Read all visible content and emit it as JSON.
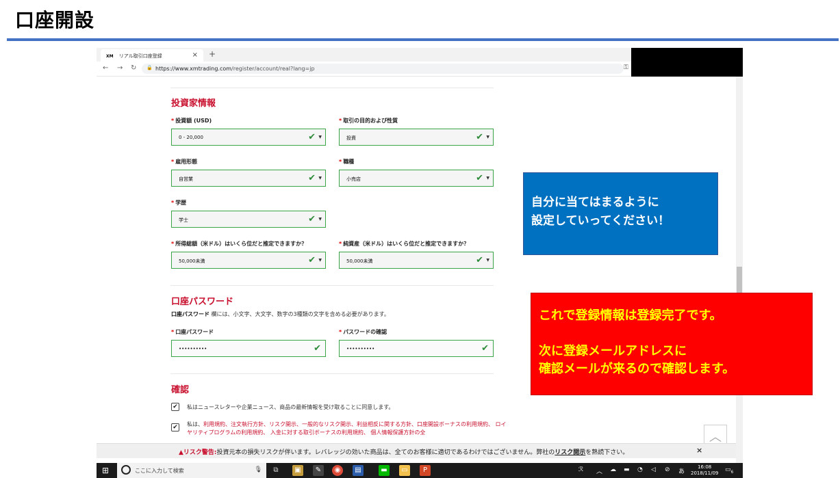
{
  "slide": {
    "title": "口座開設",
    "accent_color": "#4472c4"
  },
  "browser": {
    "tab_title": "リアル取引口座登録",
    "tab_favicon": "XM",
    "url_host": "https://www.xmtrading.com",
    "url_path": "/register/account/real?lang=jp"
  },
  "form": {
    "investor_section_title": "投資家情報",
    "investment_amount": {
      "label": "投資額 (USD)",
      "value": "0 - 20,000"
    },
    "trading_purpose": {
      "label": "取引の目的および性質",
      "value": "投資"
    },
    "employment": {
      "label": "雇用形態",
      "value": "自営業"
    },
    "occupation": {
      "label": "職種",
      "value": "小売店"
    },
    "education": {
      "label": "学歴",
      "value": "学士"
    },
    "annual_income": {
      "label": "所得総額（米ドル）はいくら位だと推定できますか？",
      "value": "50,000未満"
    },
    "net_worth": {
      "label": "純資産（米ドル）はいくら位だと推定できますか？",
      "value": "50,000未満"
    },
    "password_section_title": "口座パスワード",
    "password_desc_bold": "口座パスワード",
    "password_desc_rest": " 欄には、小文字、大文字、数字の3種類の文字を含める必要があります。",
    "password": {
      "label": "口座パスワード",
      "value": "••••••••••"
    },
    "password_confirm": {
      "label": "パスワードの確認",
      "value": "••••••••••"
    },
    "confirm_section_title": "確認",
    "newsletter_consent": "私はニュースレターや企業ニュース、商品の最新情報を受け取ることに同意します。",
    "terms_prefix": "私は、",
    "terms_text": "利用規約、注文執行方針、リスク開示、一般的なリスク開示、利益相反に関する方針、口座開設ボーナスの利用規約、 ロイヤリティプログラムの利用規約、 入金に対する取引ボーナスの利用規約、 個人情報保護方針の全",
    "required_mark": "*"
  },
  "risk_bar": {
    "warning_label": "▲リスク警告:",
    "text": "投資元本の損失リスクが伴います。レバレッジの効いた商品は、全てのお客様に適切であるわけではございません。弊社の",
    "link": "リスク開示",
    "suffix": "を熟読下さい。",
    "close": "×"
  },
  "taskbar": {
    "search_placeholder": "ここに入力して検索",
    "clock_time": "16:08",
    "clock_date": "2018/11/09",
    "notification_count": "6"
  },
  "callouts": {
    "blue_line1": "自分に当てはまるように",
    "blue_line2": "設定していってください！",
    "red_text": "これで登録情報は登録完了です。\n\n次に登録メールアドレスに\n確認メールが来るので確認します。"
  }
}
